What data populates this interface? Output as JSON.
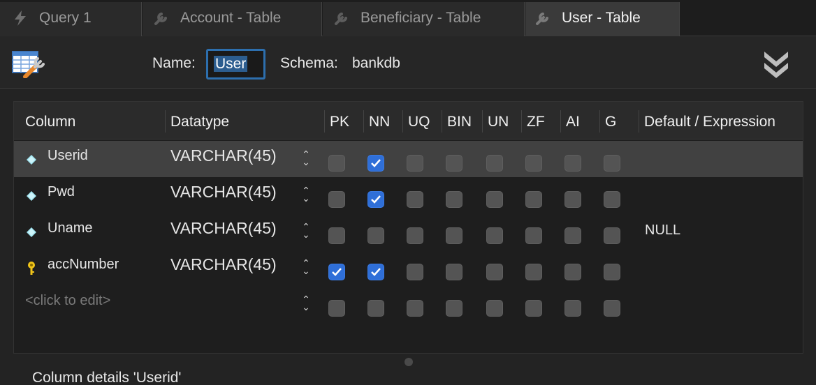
{
  "tabs": [
    {
      "label": "Query 1",
      "icon": "lightning-icon"
    },
    {
      "label": "Account - Table",
      "icon": "wrench-icon"
    },
    {
      "label": "Beneficiary - Table",
      "icon": "wrench-icon"
    },
    {
      "label": "User - Table",
      "icon": "wrench-icon",
      "active": true
    }
  ],
  "header": {
    "name_label": "Name:",
    "name_value": "User",
    "schema_label": "Schema:",
    "schema_value": "bankdb"
  },
  "grid": {
    "headers": {
      "column": "Column",
      "datatype": "Datatype",
      "pk": "PK",
      "nn": "NN",
      "uq": "UQ",
      "bin": "BIN",
      "un": "UN",
      "zf": "ZF",
      "ai": "AI",
      "g": "G",
      "default": "Default / Expression"
    },
    "rows": [
      {
        "name": "Userid",
        "datatype": "VARCHAR(45)",
        "icon": "diamond-icon",
        "flags": [
          false,
          true,
          false,
          false,
          false,
          false,
          false,
          false
        ],
        "default": "",
        "selected": true
      },
      {
        "name": "Pwd",
        "datatype": "VARCHAR(45)",
        "icon": "diamond-icon",
        "flags": [
          false,
          true,
          false,
          false,
          false,
          false,
          false,
          false
        ],
        "default": ""
      },
      {
        "name": "Uname",
        "datatype": "VARCHAR(45)",
        "icon": "diamond-icon",
        "flags": [
          false,
          false,
          false,
          false,
          false,
          false,
          false,
          false
        ],
        "default": "NULL"
      },
      {
        "name": "accNumber",
        "datatype": "VARCHAR(45)",
        "icon": "key-icon",
        "flags": [
          true,
          true,
          false,
          false,
          false,
          false,
          false,
          false
        ],
        "default": ""
      }
    ],
    "new_row_placeholder": "<click to edit>"
  },
  "details_label": "Column details 'Userid'",
  "colors": {
    "accent": "#2f6fd8",
    "background": "#232323",
    "selected_row": "#414141"
  }
}
